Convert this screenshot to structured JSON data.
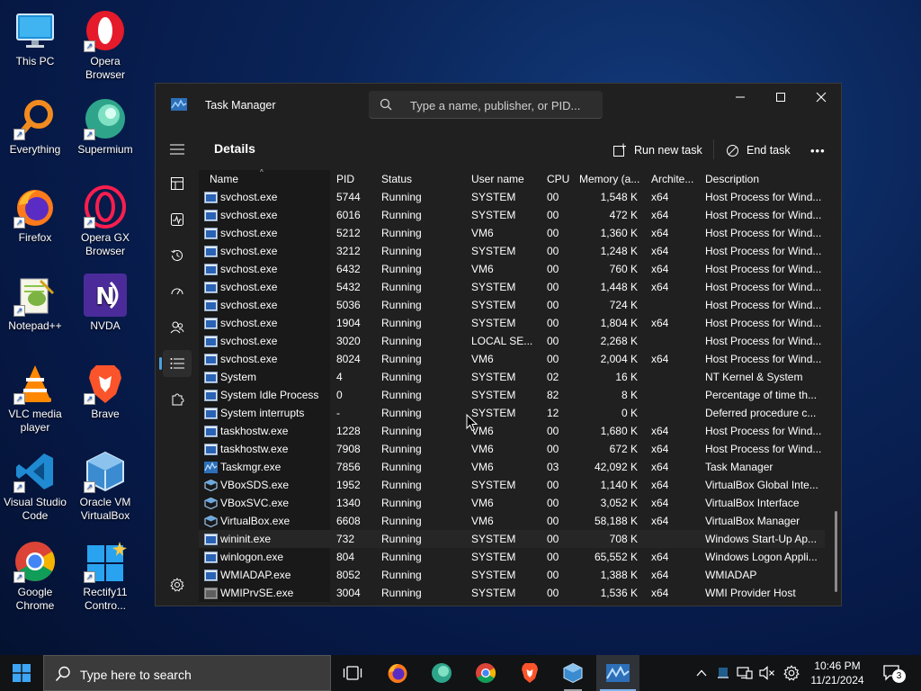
{
  "desktop": {
    "icons": [
      {
        "label": "This PC",
        "icon": "monitor-icon"
      },
      {
        "label": "Opera Browser",
        "icon": "opera-icon"
      },
      {
        "label": "Everything",
        "icon": "everything-search-icon"
      },
      {
        "label": "Supermium",
        "icon": "supermium-icon"
      },
      {
        "label": "Firefox",
        "icon": "firefox-icon"
      },
      {
        "label": "Opera GX Browser",
        "icon": "opera-gx-icon"
      },
      {
        "label": "Notepad++",
        "icon": "notepad-plus-plus-icon"
      },
      {
        "label": "NVDA",
        "icon": "nvda-icon"
      },
      {
        "label": "VLC media player",
        "icon": "vlc-icon"
      },
      {
        "label": "Brave",
        "icon": "brave-icon"
      },
      {
        "label": "Visual Studio Code",
        "icon": "vscode-icon"
      },
      {
        "label": "Oracle VM VirtualBox",
        "icon": "virtualbox-icon"
      },
      {
        "label": "Google Chrome",
        "icon": "chrome-icon"
      },
      {
        "label": "Rectify11 Contro...",
        "icon": "rectify11-icon"
      }
    ]
  },
  "task_manager": {
    "title": "Task Manager",
    "search_placeholder": "Type a name, publisher, or PID...",
    "page_title": "Details",
    "run_new_task": "Run new task",
    "end_task": "End task",
    "more": "•••",
    "columns": {
      "name": "Name",
      "pid": "PID",
      "status": "Status",
      "user": "User name",
      "cpu": "CPU",
      "memory": "Memory (a...",
      "arch": "Archite...",
      "desc": "Description"
    },
    "rows": [
      {
        "name": "svchost.exe",
        "pid": "5744",
        "status": "Running",
        "user": "SYSTEM",
        "cpu": "00",
        "memory": "1,548 K",
        "arch": "x64",
        "desc": "Host Process for Wind..."
      },
      {
        "name": "svchost.exe",
        "pid": "6016",
        "status": "Running",
        "user": "SYSTEM",
        "cpu": "00",
        "memory": "472 K",
        "arch": "x64",
        "desc": "Host Process for Wind..."
      },
      {
        "name": "svchost.exe",
        "pid": "5212",
        "status": "Running",
        "user": "VM6",
        "cpu": "00",
        "memory": "1,360 K",
        "arch": "x64",
        "desc": "Host Process for Wind..."
      },
      {
        "name": "svchost.exe",
        "pid": "3212",
        "status": "Running",
        "user": "SYSTEM",
        "cpu": "00",
        "memory": "1,248 K",
        "arch": "x64",
        "desc": "Host Process for Wind..."
      },
      {
        "name": "svchost.exe",
        "pid": "6432",
        "status": "Running",
        "user": "VM6",
        "cpu": "00",
        "memory": "760 K",
        "arch": "x64",
        "desc": "Host Process for Wind..."
      },
      {
        "name": "svchost.exe",
        "pid": "5432",
        "status": "Running",
        "user": "SYSTEM",
        "cpu": "00",
        "memory": "1,448 K",
        "arch": "x64",
        "desc": "Host Process for Wind..."
      },
      {
        "name": "svchost.exe",
        "pid": "5036",
        "status": "Running",
        "user": "SYSTEM",
        "cpu": "00",
        "memory": "724 K",
        "arch": "",
        "desc": "Host Process for Wind..."
      },
      {
        "name": "svchost.exe",
        "pid": "1904",
        "status": "Running",
        "user": "SYSTEM",
        "cpu": "00",
        "memory": "1,804 K",
        "arch": "x64",
        "desc": "Host Process for Wind..."
      },
      {
        "name": "svchost.exe",
        "pid": "3020",
        "status": "Running",
        "user": "LOCAL SE...",
        "cpu": "00",
        "memory": "2,268 K",
        "arch": "",
        "desc": "Host Process for Wind..."
      },
      {
        "name": "svchost.exe",
        "pid": "8024",
        "status": "Running",
        "user": "VM6",
        "cpu": "00",
        "memory": "2,004 K",
        "arch": "x64",
        "desc": "Host Process for Wind..."
      },
      {
        "name": "System",
        "pid": "4",
        "status": "Running",
        "user": "SYSTEM",
        "cpu": "02",
        "memory": "16 K",
        "arch": "",
        "desc": "NT Kernel & System"
      },
      {
        "name": "System Idle Process",
        "pid": "0",
        "status": "Running",
        "user": "SYSTEM",
        "cpu": "82",
        "memory": "8 K",
        "arch": "",
        "desc": "Percentage of time th..."
      },
      {
        "name": "System interrupts",
        "pid": "-",
        "status": "Running",
        "user": "SYSTEM",
        "cpu": "12",
        "memory": "0 K",
        "arch": "",
        "desc": "Deferred procedure c..."
      },
      {
        "name": "taskhostw.exe",
        "pid": "1228",
        "status": "Running",
        "user": "VM6",
        "cpu": "00",
        "memory": "1,680 K",
        "arch": "x64",
        "desc": "Host Process for Wind..."
      },
      {
        "name": "taskhostw.exe",
        "pid": "7908",
        "status": "Running",
        "user": "VM6",
        "cpu": "00",
        "memory": "672 K",
        "arch": "x64",
        "desc": "Host Process for Wind..."
      },
      {
        "name": "Taskmgr.exe",
        "pid": "7856",
        "status": "Running",
        "user": "VM6",
        "cpu": "03",
        "memory": "42,092 K",
        "arch": "x64",
        "desc": "Task Manager"
      },
      {
        "name": "VBoxSDS.exe",
        "pid": "1952",
        "status": "Running",
        "user": "SYSTEM",
        "cpu": "00",
        "memory": "1,140 K",
        "arch": "x64",
        "desc": "VirtualBox Global Inte..."
      },
      {
        "name": "VBoxSVC.exe",
        "pid": "1340",
        "status": "Running",
        "user": "VM6",
        "cpu": "00",
        "memory": "3,052 K",
        "arch": "x64",
        "desc": "VirtualBox Interface"
      },
      {
        "name": "VirtualBox.exe",
        "pid": "6608",
        "status": "Running",
        "user": "VM6",
        "cpu": "00",
        "memory": "58,188 K",
        "arch": "x64",
        "desc": "VirtualBox Manager"
      },
      {
        "name": "wininit.exe",
        "pid": "732",
        "status": "Running",
        "user": "SYSTEM",
        "cpu": "00",
        "memory": "708 K",
        "arch": "",
        "desc": "Windows Start-Up Ap..."
      },
      {
        "name": "winlogon.exe",
        "pid": "804",
        "status": "Running",
        "user": "SYSTEM",
        "cpu": "00",
        "memory": "65,552 K",
        "arch": "x64",
        "desc": "Windows Logon Appli..."
      },
      {
        "name": "WMIADAP.exe",
        "pid": "8052",
        "status": "Running",
        "user": "SYSTEM",
        "cpu": "00",
        "memory": "1,388 K",
        "arch": "x64",
        "desc": "WMIADAP"
      },
      {
        "name": "WMIPrvSE.exe",
        "pid": "3004",
        "status": "Running",
        "user": "SYSTEM",
        "cpu": "00",
        "memory": "1,536 K",
        "arch": "x64",
        "desc": "WMI Provider Host"
      }
    ]
  },
  "taskbar": {
    "search_placeholder": "Type here to search",
    "time": "10:46 PM",
    "date": "11/21/2024",
    "notification_count": "3"
  }
}
